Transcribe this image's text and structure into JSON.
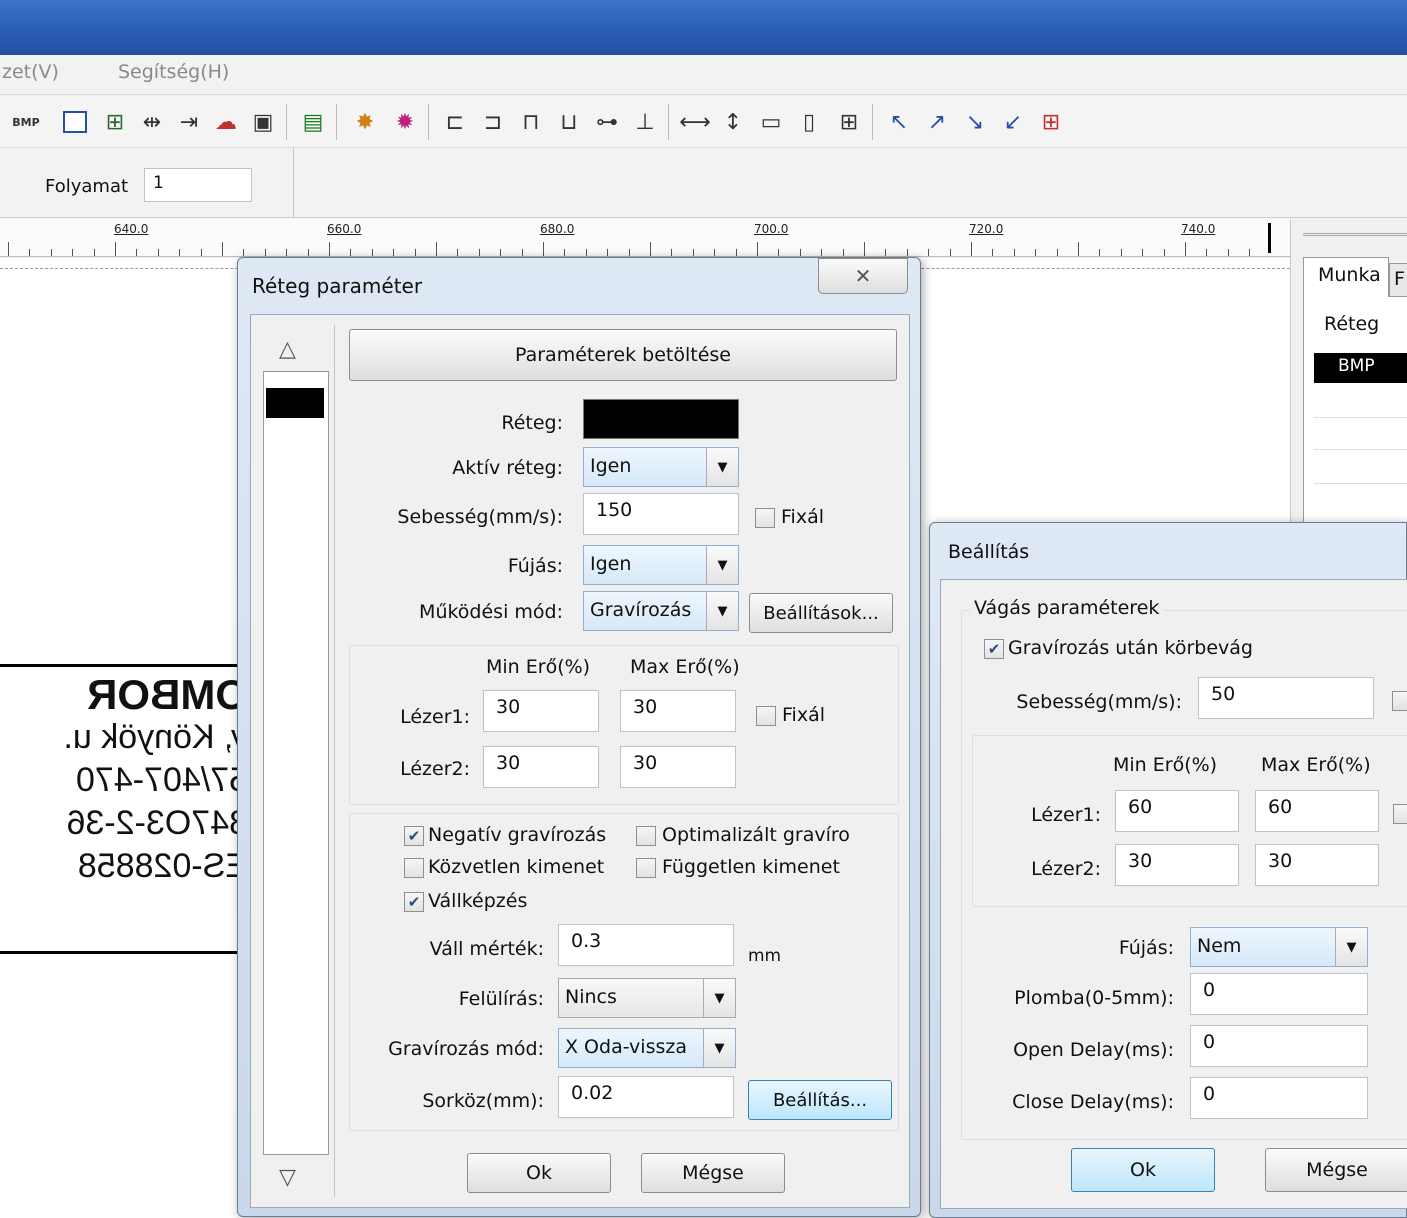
{
  "menu": {
    "view_label": "zet(V)",
    "help_label": "Segítség(H)"
  },
  "toolbar": {
    "bmp_label": "BMP"
  },
  "propbar": {
    "process_label": "Folyamat",
    "process_value": "1"
  },
  "ruler": {
    "labels": [
      "640.0",
      "660.0",
      "680.0",
      "700.0",
      "720.0",
      "740.0"
    ]
  },
  "canvas_text": {
    "line1": "OMBOR",
    "line2": "y, Könyök u.",
    "line3": "57/407-470",
    "line4": "847O3-2-36",
    "line5": "ES-028858"
  },
  "right_panel": {
    "tab_munka": "Munka",
    "tab_f": "F",
    "header": "Réteg",
    "row1": "BMP"
  },
  "layer_dialog": {
    "title": "Réteg paraméter",
    "load_button": "Paraméterek betöltése",
    "layer_label": "Réteg:",
    "layer_color": "#000000",
    "active_label": "Aktív réteg:",
    "active_value": "Igen",
    "speed_label": "Sebesség(mm/s):",
    "speed_value": "150",
    "fix_label": "Fixál",
    "blow_label": "Fújás:",
    "blow_value": "Igen",
    "mode_label": "Működési mód:",
    "mode_value": "Gravírozás",
    "settings_button": "Beállítások...",
    "min_power_header": "Min Erő(%)",
    "max_power_header": "Max Erő(%)",
    "laser1_label": "Lézer1:",
    "laser1_min": "30",
    "laser1_max": "30",
    "laser2_label": "Lézer2:",
    "laser2_min": "30",
    "laser2_max": "30",
    "fix2_label": "Fixál",
    "cb_negative": "Negatív gravírozás",
    "cb_optimized": "Optimalizált gravíro",
    "cb_direct": "Közvetlen kimenet",
    "cb_independent": "Független kimenet",
    "cb_shoulder": "Vállképzés",
    "shoulder_label": "Váll mérték:",
    "shoulder_value": "0.3",
    "shoulder_unit": "mm",
    "overwrite_label": "Felülírás:",
    "overwrite_value": "Nincs",
    "engrave_mode_label": "Gravírozás mód:",
    "engrave_mode_value": "X Oda-vissza",
    "line_spacing_label": "Sorköz(mm):",
    "line_spacing_value": "0.02",
    "setting_button": "Beállítás...",
    "ok_button": "Ok",
    "cancel_button": "Mégse"
  },
  "settings_dialog": {
    "title": "Beállítás",
    "group_title": "Vágás paraméterek",
    "cb_cut_after": "Gravírozás után körbevág",
    "speed_label": "Sebesség(mm/s):",
    "speed_value": "50",
    "min_power_header": "Min Erő(%)",
    "max_power_header": "Max Erő(%)",
    "laser1_label": "Lézer1:",
    "laser1_min": "60",
    "laser1_max": "60",
    "laser2_label": "Lézer2:",
    "laser2_min": "30",
    "laser2_max": "30",
    "blow_label": "Fújás:",
    "blow_value": "Nem",
    "seal_label": "Plomba(0-5mm):",
    "seal_value": "0",
    "open_delay_label": "Open Delay(ms):",
    "open_delay_value": "0",
    "close_delay_label": "Close Delay(ms):",
    "close_delay_value": "0",
    "ok_button": "Ok",
    "cancel_button": "Mégse"
  }
}
